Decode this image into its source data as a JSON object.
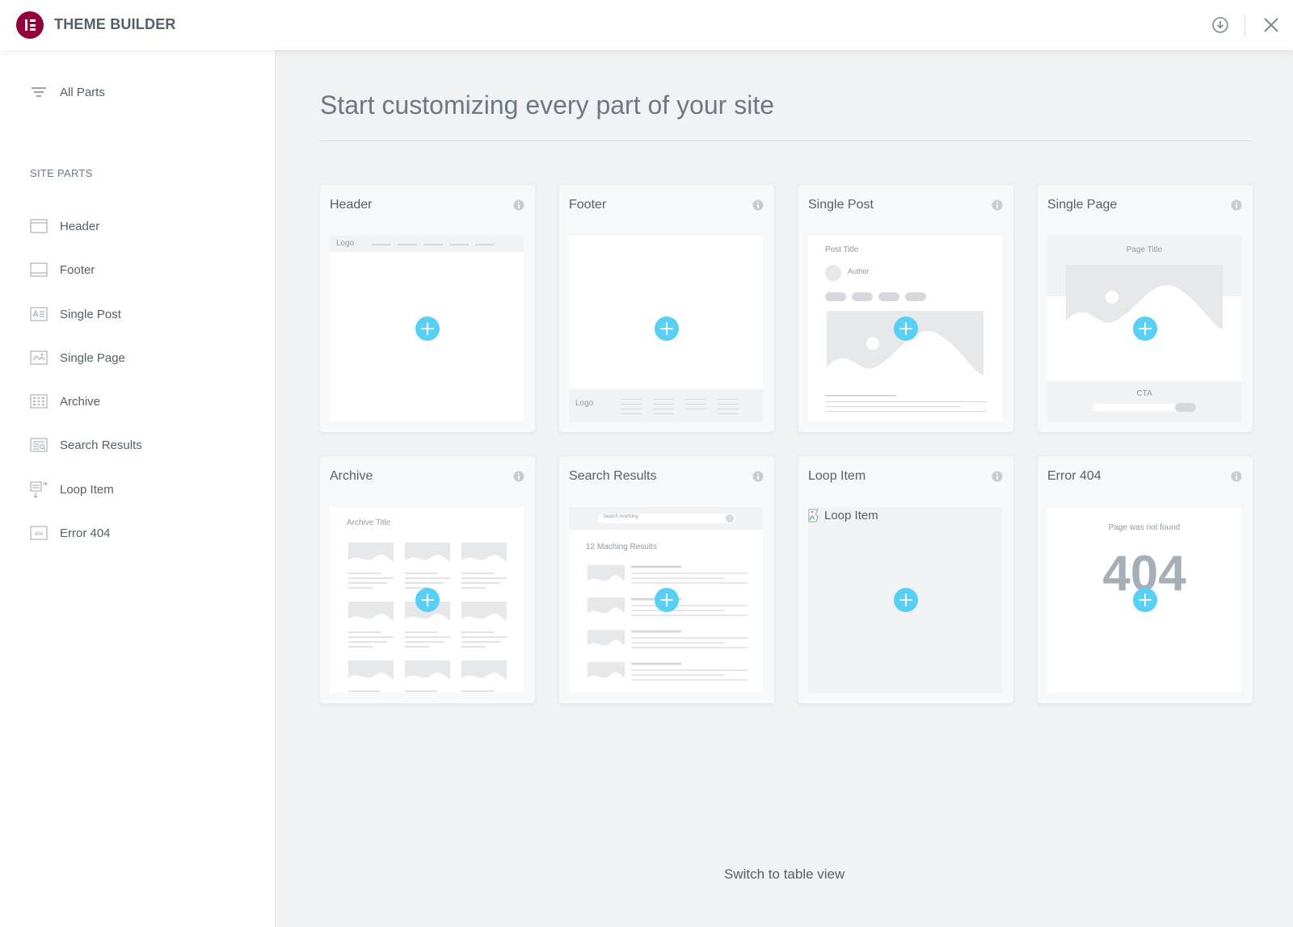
{
  "app": {
    "title": "THEME BUILDER",
    "brand_color": "#92003b",
    "accent_color": "#58d0f5"
  },
  "topbar": {
    "icons": [
      "download-icon",
      "close-icon"
    ]
  },
  "sidebar": {
    "all_parts_label": "All Parts",
    "section_label": "SITE PARTS",
    "items": [
      {
        "label": "Header",
        "icon": "header-icon"
      },
      {
        "label": "Footer",
        "icon": "footer-icon"
      },
      {
        "label": "Single Post",
        "icon": "single-post-icon"
      },
      {
        "label": "Single Page",
        "icon": "single-page-icon"
      },
      {
        "label": "Archive",
        "icon": "archive-icon"
      },
      {
        "label": "Search Results",
        "icon": "search-results-icon"
      },
      {
        "label": "Loop Item",
        "icon": "loop-item-icon"
      },
      {
        "label": "Error 404",
        "icon": "error-404-icon"
      }
    ]
  },
  "main": {
    "title": "Start customizing every part of your site",
    "switch_view_label": "Switch to table view"
  },
  "cards": [
    {
      "title": "Header",
      "preview": {
        "logo": "Logo"
      }
    },
    {
      "title": "Footer",
      "preview": {
        "logo": "Logo"
      }
    },
    {
      "title": "Single Post",
      "preview": {
        "post_title": "Post Title",
        "author": "Author"
      }
    },
    {
      "title": "Single Page",
      "preview": {
        "page_title": "Page Title",
        "cta": "CTA"
      }
    },
    {
      "title": "Archive",
      "preview": {
        "archive_title": "Archive Title"
      }
    },
    {
      "title": "Search Results",
      "preview": {
        "search_placeholder": "Search Anything",
        "results_text": "12 Maching Results"
      }
    },
    {
      "title": "Loop Item",
      "preview": {
        "broken_image_alt": "Loop Item"
      }
    },
    {
      "title": "Error 404",
      "preview": {
        "not_found_text": "Page was not found",
        "code": "404"
      }
    }
  ]
}
